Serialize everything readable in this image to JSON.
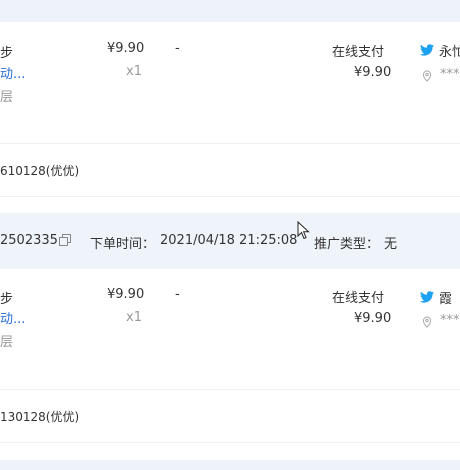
{
  "orders": [
    {
      "product": {
        "title": "步",
        "link": "动...",
        "spec": "层"
      },
      "price": "¥9.90",
      "quantity": "x1",
      "discount": "-",
      "payment_method": "在线支付",
      "paid_amount": "¥9.90",
      "buyer": {
        "name": "永忙",
        "address_masked": "***"
      },
      "remark": "610128(优优)"
    },
    {
      "order_no_fragment": "2502335",
      "order_time_label": "下单时间：",
      "order_time": "2021/04/18 21:25:08",
      "promo_label": "推广类型：",
      "promo_type": "无",
      "product": {
        "title": "步",
        "link": "动...",
        "spec": "层"
      },
      "price": "¥9.90",
      "quantity": "x1",
      "discount": "-",
      "payment_method": "在线支付",
      "paid_amount": "¥9.90",
      "buyer": {
        "name": "霞",
        "address_masked": "***"
      },
      "remark": "130128(优优)"
    }
  ],
  "colors": {
    "band": "#eff4fb",
    "link": "#2a6fd6",
    "muted": "#999999",
    "divider": "#edf0f4",
    "bird": "#1da1f2"
  },
  "icons": [
    "bird-icon",
    "location-pin-icon",
    "copy-icon",
    "mouse-cursor-icon"
  ]
}
